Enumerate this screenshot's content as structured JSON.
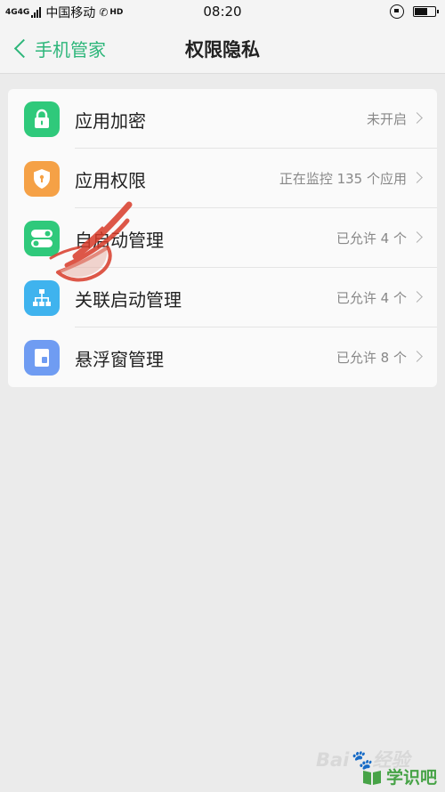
{
  "status_bar": {
    "signal": "4G4G",
    "carrier": "中国移动",
    "hd": "HD",
    "time": "08:20"
  },
  "header": {
    "back_label": "手机管家",
    "title": "权限隐私"
  },
  "list": [
    {
      "label": "应用加密",
      "value": "未开启",
      "icon": "lock-icon",
      "color": "#2fc97b"
    },
    {
      "label": "应用权限",
      "value": "正在监控 135 个应用",
      "icon": "shield-icon",
      "color": "#f5a146"
    },
    {
      "label": "自启动管理",
      "value": "已允许 4 个",
      "icon": "toggle-icon",
      "color": "#2fc97b"
    },
    {
      "label": "关联启动管理",
      "value": "已允许 4 个",
      "icon": "hierarchy-icon",
      "color": "#3fb3ee"
    },
    {
      "label": "悬浮窗管理",
      "value": "已允许 8 个",
      "icon": "floating-window-icon",
      "color": "#6f9cf2"
    }
  ],
  "watermark": {
    "baidu": "Bai🐾经验",
    "learn": "学识吧"
  },
  "battery_level": 0.7
}
